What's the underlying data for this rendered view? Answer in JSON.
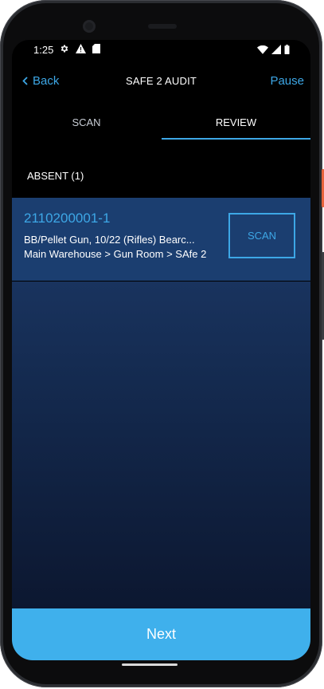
{
  "status_bar": {
    "time": "1:25"
  },
  "navbar": {
    "back_label": "Back",
    "title": "SAFE 2 AUDIT",
    "pause_label": "Pause"
  },
  "tabs": [
    {
      "label": "SCAN",
      "active": false
    },
    {
      "label": "REVIEW",
      "active": true
    }
  ],
  "section": {
    "header": "ABSENT (1)"
  },
  "items": [
    {
      "id": "2110200001-1",
      "description": "BB/Pellet Gun, 10/22 (Rifles) Bearc...",
      "location": "Main Warehouse > Gun Room > SAfe 2",
      "action_label": "SCAN"
    }
  ],
  "footer": {
    "next_label": "Next"
  },
  "colors": {
    "accent": "#3da7e6",
    "button": "#3fb0ec",
    "item_background": "#1b3e70",
    "background": "#000000"
  },
  "icons": {
    "back": "chevron-left-icon",
    "settings": "gear-icon",
    "warning": "warning-icon",
    "sim": "sim-card-icon",
    "wifi": "wifi-icon",
    "signal": "signal-icon",
    "battery": "battery-icon"
  }
}
